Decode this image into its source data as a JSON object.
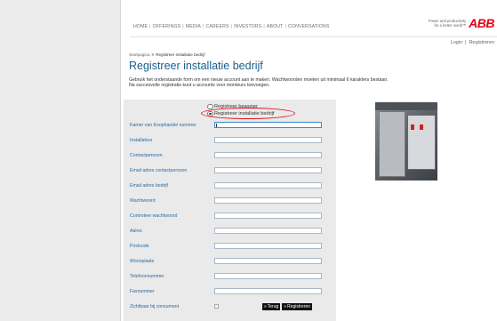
{
  "nav": {
    "items": [
      "HOME",
      "OFFERINGS",
      "MEDIA",
      "CAREERS",
      "INVESTORS",
      "ABOUT",
      "CONVERSATIONS"
    ],
    "separator": "|"
  },
  "brand": {
    "tagline_line1": "Power and productivity",
    "tagline_line2": "for a better world™",
    "logo_text": "ABB",
    "logo_color": "#e2001a"
  },
  "account": {
    "login": "Login",
    "separator": "|",
    "register": "Registreren"
  },
  "breadcrumb": {
    "home": "Startpagina",
    "arrow": ">",
    "current": "Registreer installatie bedrijf"
  },
  "page": {
    "title": "Registreer installatie bedrijf",
    "intro_line1": "Gebruik het onderstaande form om een nieuw account aan te maken. Wachtwoorden moeten uit minimaal 6 karakters bestaan.",
    "intro_line2": "Na succesvolle registratie kunt u accounts voor monteurs toevoegen."
  },
  "form": {
    "radio_options": [
      {
        "label": "Registreer bewoner",
        "selected": false
      },
      {
        "label": "Registreer installatie bedrijf",
        "selected": true
      }
    ],
    "fields": [
      {
        "label": "Kamer van Koophandel nummer",
        "value": ""
      },
      {
        "label": "Installateur",
        "value": ""
      },
      {
        "label": "Contactpersoon",
        "value": ""
      },
      {
        "label": "Email adres contactpersoon",
        "value": ""
      },
      {
        "label": "Email adres bedrijf",
        "value": ""
      },
      {
        "label": "Wachtwoord",
        "value": ""
      },
      {
        "label": "Controleer wachtwoord",
        "value": ""
      },
      {
        "label": "Adres",
        "value": ""
      },
      {
        "label": "Postcode",
        "value": ""
      },
      {
        "label": "Woonplaats",
        "value": ""
      },
      {
        "label": "Telefoonnummer",
        "value": ""
      },
      {
        "label": "Faxnummer",
        "value": ""
      }
    ],
    "checkbox_field": {
      "label": "Zichtbaar bij consument",
      "checked": false
    },
    "back_button": "Terug",
    "register_button": "Registreren",
    "button_arrow": "»"
  },
  "colors": {
    "accent_blue": "#1a5f8a",
    "label_blue": "#2a6aa0",
    "highlight_red": "#e2101a"
  }
}
